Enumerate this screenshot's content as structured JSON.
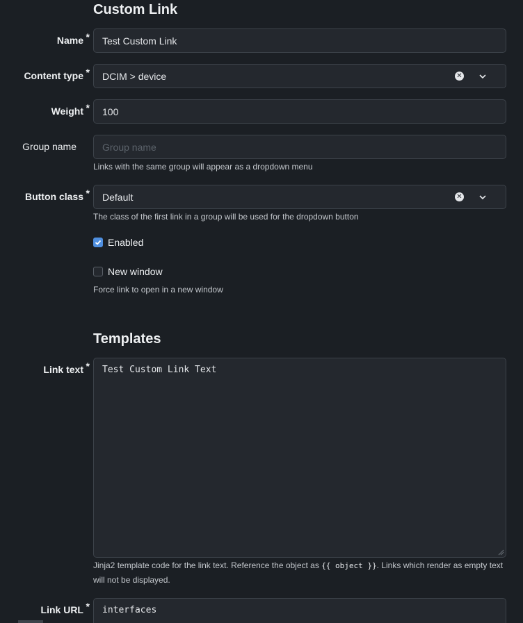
{
  "form": {
    "section_custom_link": "Custom Link",
    "section_templates": "Templates",
    "name": {
      "label": "Name",
      "value": "Test Custom Link"
    },
    "content_type": {
      "label": "Content type",
      "value": "DCIM > device"
    },
    "weight": {
      "label": "Weight",
      "value": "100"
    },
    "group_name": {
      "label": "Group name",
      "placeholder": "Group name",
      "help": "Links with the same group will appear as a dropdown menu"
    },
    "button_class": {
      "label": "Button class",
      "value": "Default",
      "help": "The class of the first link in a group will be used for the dropdown button"
    },
    "enabled": {
      "label": "Enabled",
      "checked": true
    },
    "new_window": {
      "label": "New window",
      "checked": false,
      "help": "Force link to open in a new window"
    },
    "link_text": {
      "label": "Link text",
      "value": "Test Custom Link Text",
      "help_prefix": "Jinja2 template code for the link text. Reference the object as ",
      "help_code": "{{ object }}",
      "help_suffix": ". Links which render as empty text will not be displayed."
    },
    "link_url": {
      "label": "Link URL",
      "value": "interfaces"
    },
    "required_marker": "*"
  },
  "colors": {
    "background": "#1b1f24",
    "field_bg": "#24282e",
    "border": "#3d434a",
    "accent": "#4f8fe0"
  }
}
